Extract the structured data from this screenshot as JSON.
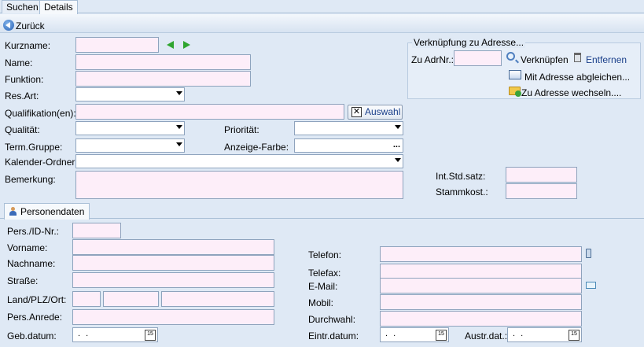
{
  "tabs": {
    "search": "Suchen",
    "details": "Details"
  },
  "back": {
    "label": "Zurück"
  },
  "form": {
    "kurzname": "Kurzname:",
    "name": "Name:",
    "funktion": "Funktion:",
    "resart": "Res.Art:",
    "qualifikation": "Qualifikation(en):",
    "auswahl": "Auswahl",
    "qualitaet": "Qualität:",
    "prioritaet": "Priorität:",
    "termgruppe": "Term.Gruppe:",
    "anzeigefarbe": "Anzeige-Farbe:",
    "anzeigefarbe_btn": "...",
    "kalenderordner": "Kalender-Ordner:",
    "bemerkung": "Bemerkung:",
    "intstdsatz": "Int.Std.satz:",
    "stammkost": "Stammkost.:"
  },
  "address_link": {
    "title": "Verknüpfung zu Adresse...",
    "zuadrnr": "Zu AdrNr.:",
    "verknuepfen": "Verknüpfen",
    "entfernen": "Entfernen",
    "abgleichen": "Mit Adresse abgleichen...",
    "wechseln": "Zu Adresse wechseln...."
  },
  "person_tab": "Personendaten",
  "person": {
    "persid": "Pers./ID-Nr.:",
    "vorname": "Vorname:",
    "nachname": "Nachname:",
    "strasse": "Straße:",
    "landplzort": "Land/PLZ/Ort:",
    "persanrede": "Pers.Anrede:",
    "gebdatum": "Geb.datum:",
    "telefon": "Telefon:",
    "telefax": "Telefax:",
    "email": "E-Mail:",
    "mobil": "Mobil:",
    "durchwahl": "Durchwahl:",
    "eintrdatum": "Eintr.datum:",
    "austrdat": "Austr.dat.:",
    "date_placeholder": ". .",
    "cal_icon_text": "15"
  }
}
